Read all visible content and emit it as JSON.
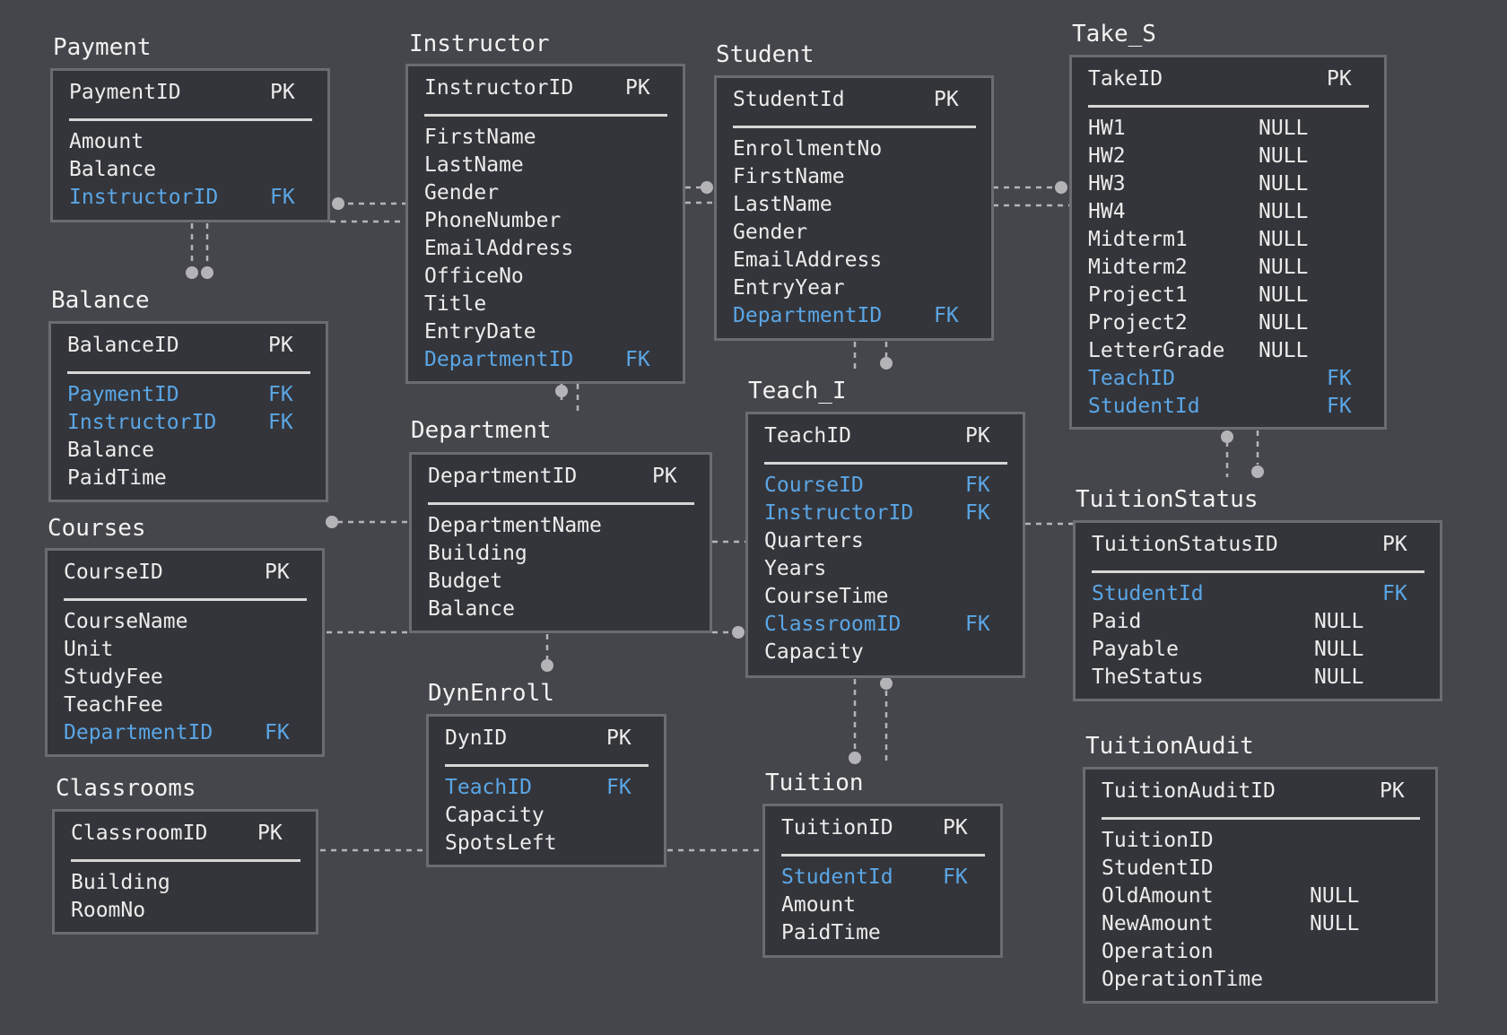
{
  "colors": {
    "background": "#45464b",
    "table_fill": "#34353a",
    "table_border": "#6b6c70",
    "text": "#ececec",
    "foreign_key": "#5aa6e6",
    "connector": "#b4b4b8"
  },
  "tables": {
    "payment": {
      "title": "Payment",
      "key": "PaymentID",
      "key_tag": "PK",
      "fields": [
        {
          "name": "Amount",
          "tag": ""
        },
        {
          "name": "Balance",
          "tag": ""
        },
        {
          "name": "InstructorID",
          "tag": "FK"
        }
      ]
    },
    "balance": {
      "title": "Balance",
      "key": "BalanceID",
      "key_tag": "PK",
      "fields": [
        {
          "name": "PaymentID",
          "tag": "FK"
        },
        {
          "name": "InstructorID",
          "tag": "FK"
        },
        {
          "name": "Balance",
          "tag": ""
        },
        {
          "name": "PaidTime",
          "tag": ""
        }
      ]
    },
    "courses": {
      "title": "Courses",
      "key": "CourseID",
      "key_tag": "PK",
      "fields": [
        {
          "name": "CourseName",
          "tag": ""
        },
        {
          "name": "Unit",
          "tag": ""
        },
        {
          "name": "StudyFee",
          "tag": ""
        },
        {
          "name": "TeachFee",
          "tag": ""
        },
        {
          "name": "DepartmentID",
          "tag": "FK"
        }
      ]
    },
    "classrooms": {
      "title": "Classrooms",
      "key": "ClassroomID",
      "key_tag": "PK",
      "fields": [
        {
          "name": "Building",
          "tag": ""
        },
        {
          "name": "RoomNo",
          "tag": ""
        }
      ]
    },
    "instructor": {
      "title": "Instructor",
      "key": "InstructorID",
      "key_tag": "PK",
      "fields": [
        {
          "name": "FirstName",
          "tag": ""
        },
        {
          "name": "LastName",
          "tag": ""
        },
        {
          "name": "Gender",
          "tag": ""
        },
        {
          "name": "PhoneNumber",
          "tag": ""
        },
        {
          "name": "EmailAddress",
          "tag": ""
        },
        {
          "name": "OfficeNo",
          "tag": ""
        },
        {
          "name": "Title",
          "tag": ""
        },
        {
          "name": "EntryDate",
          "tag": ""
        },
        {
          "name": "DepartmentID",
          "tag": "FK"
        }
      ]
    },
    "department": {
      "title": "Department",
      "key": "DepartmentID",
      "key_tag": "PK",
      "fields": [
        {
          "name": "DepartmentName",
          "tag": ""
        },
        {
          "name": "Building",
          "tag": ""
        },
        {
          "name": "Budget",
          "tag": ""
        },
        {
          "name": "Balance",
          "tag": ""
        }
      ]
    },
    "dynenroll": {
      "title": "DynEnroll",
      "key": "DynID",
      "key_tag": "PK",
      "fields": [
        {
          "name": "TeachID",
          "tag": "FK"
        },
        {
          "name": "Capacity",
          "tag": ""
        },
        {
          "name": "SpotsLeft",
          "tag": ""
        }
      ]
    },
    "student": {
      "title": "Student",
      "key": "StudentId",
      "key_tag": "PK",
      "fields": [
        {
          "name": "EnrollmentNo",
          "tag": ""
        },
        {
          "name": "FirstName",
          "tag": ""
        },
        {
          "name": "LastName",
          "tag": ""
        },
        {
          "name": "Gender",
          "tag": ""
        },
        {
          "name": "EmailAddress",
          "tag": ""
        },
        {
          "name": "EntryYear",
          "tag": ""
        },
        {
          "name": "DepartmentID",
          "tag": "FK"
        }
      ]
    },
    "teach_i": {
      "title": "Teach_I",
      "key": "TeachID",
      "key_tag": "PK",
      "fields": [
        {
          "name": "CourseID",
          "tag": "FK"
        },
        {
          "name": "InstructorID",
          "tag": "FK"
        },
        {
          "name": "Quarters",
          "tag": ""
        },
        {
          "name": "Years",
          "tag": ""
        },
        {
          "name": "CourseTime",
          "tag": ""
        },
        {
          "name": "ClassroomID",
          "tag": "FK"
        },
        {
          "name": "Capacity",
          "tag": ""
        }
      ]
    },
    "tuition": {
      "title": "Tuition",
      "key": "TuitionID",
      "key_tag": "PK",
      "fields": [
        {
          "name": "StudentId",
          "tag": "FK"
        },
        {
          "name": "Amount",
          "tag": ""
        },
        {
          "name": "PaidTime",
          "tag": ""
        }
      ]
    },
    "take_s": {
      "title": "Take_S",
      "key": "TakeID",
      "key_tag": "PK",
      "fields": [
        {
          "name": "HW1",
          "tag": "NULL"
        },
        {
          "name": "HW2",
          "tag": "NULL"
        },
        {
          "name": "HW3",
          "tag": "NULL"
        },
        {
          "name": "HW4",
          "tag": "NULL"
        },
        {
          "name": "Midterm1",
          "tag": "NULL"
        },
        {
          "name": "Midterm2",
          "tag": "NULL"
        },
        {
          "name": "Project1",
          "tag": "NULL"
        },
        {
          "name": "Project2",
          "tag": "NULL"
        },
        {
          "name": "LetterGrade",
          "tag": "NULL"
        },
        {
          "name": "TeachID",
          "tag": "FK"
        },
        {
          "name": "StudentId",
          "tag": "FK"
        }
      ]
    },
    "tuitionstatus": {
      "title": "TuitionStatus",
      "key": "TuitionStatusID",
      "key_tag": "PK",
      "fields": [
        {
          "name": "StudentId",
          "tag": "FK"
        },
        {
          "name": "Paid",
          "tag": "NULL"
        },
        {
          "name": "Payable",
          "tag": "NULL"
        },
        {
          "name": "TheStatus",
          "tag": "NULL"
        }
      ]
    },
    "tuitionaudit": {
      "title": "TuitionAudit",
      "key": "TuitionAuditID",
      "key_tag": "PK",
      "fields": [
        {
          "name": "TuitionID",
          "tag": ""
        },
        {
          "name": "StudentID",
          "tag": ""
        },
        {
          "name": "OldAmount",
          "tag": "NULL"
        },
        {
          "name": "NewAmount",
          "tag": "NULL"
        },
        {
          "name": "Operation",
          "tag": ""
        },
        {
          "name": "OperationTime",
          "tag": ""
        }
      ]
    }
  }
}
